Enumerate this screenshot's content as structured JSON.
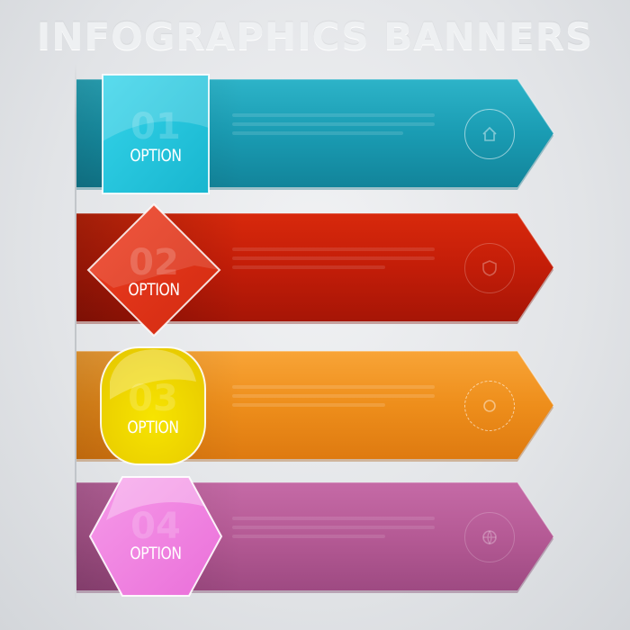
{
  "title": "INFOGRAPHICS BANNERS",
  "options": [
    {
      "number": "01",
      "label": "OPTION",
      "color": "#1a9cb3",
      "icon": "home-icon",
      "shape": "square"
    },
    {
      "number": "02",
      "label": "OPTION",
      "color": "#c31d08",
      "icon": "shield-icon",
      "shape": "diamond"
    },
    {
      "number": "03",
      "label": "OPTION",
      "color": "#ee8e1b",
      "icon": "target-icon",
      "shape": "rounded-square"
    },
    {
      "number": "04",
      "label": "OPTION",
      "color": "#b55a95",
      "icon": "globe-icon",
      "shape": "hexagon"
    }
  ]
}
